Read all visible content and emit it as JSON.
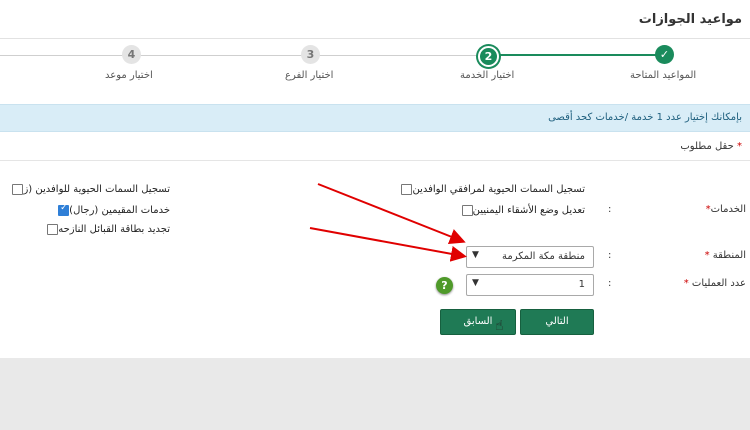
{
  "header": {
    "title": "مواعيد الجوازات"
  },
  "steps": [
    {
      "number": "✓",
      "label": "المواعيد المتاحة",
      "state": "done"
    },
    {
      "number": "2",
      "label": "اختيار الخدمة",
      "state": "current"
    },
    {
      "number": "3",
      "label": "اختيار الفرع",
      "state": "todo"
    },
    {
      "number": "4",
      "label": "اختيار موعد",
      "state": "todo"
    }
  ],
  "info": {
    "text": "بإمكانك إختيار عدد 1 خدمة /خدمات كحد أقصى"
  },
  "required_note": {
    "star": "*",
    "text": "حقل مطلوب"
  },
  "form": {
    "services_label": "الخدمات",
    "region_label": "المنطقة",
    "ops_label": "عدد العمليات",
    "star": "*",
    "colon": ":",
    "services_right": [
      {
        "label": "تسجيل السمات الحيوية لمرافقي الوافدين",
        "checked": false
      },
      {
        "label": "تعديل وضع الأشقاء اليمنيين",
        "checked": false
      }
    ],
    "services_left": [
      {
        "label": "تسجيل السمات الحيوية للوافدين (ز",
        "checked": false
      },
      {
        "label": "خدمات المقيمين (رجال)",
        "checked": true
      },
      {
        "label": "تجديد بطاقة القبائل النازحه",
        "checked": false
      }
    ],
    "region_value": "منطقة مكة المكرمة",
    "ops_value": "1",
    "help_glyph": "?"
  },
  "buttons": {
    "next": "التالي",
    "prev": "السابق"
  },
  "colors": {
    "accent": "#1a8b5c",
    "info_bg": "#d9edf7",
    "arrow": "#e00000",
    "button": "#1f7a55"
  }
}
